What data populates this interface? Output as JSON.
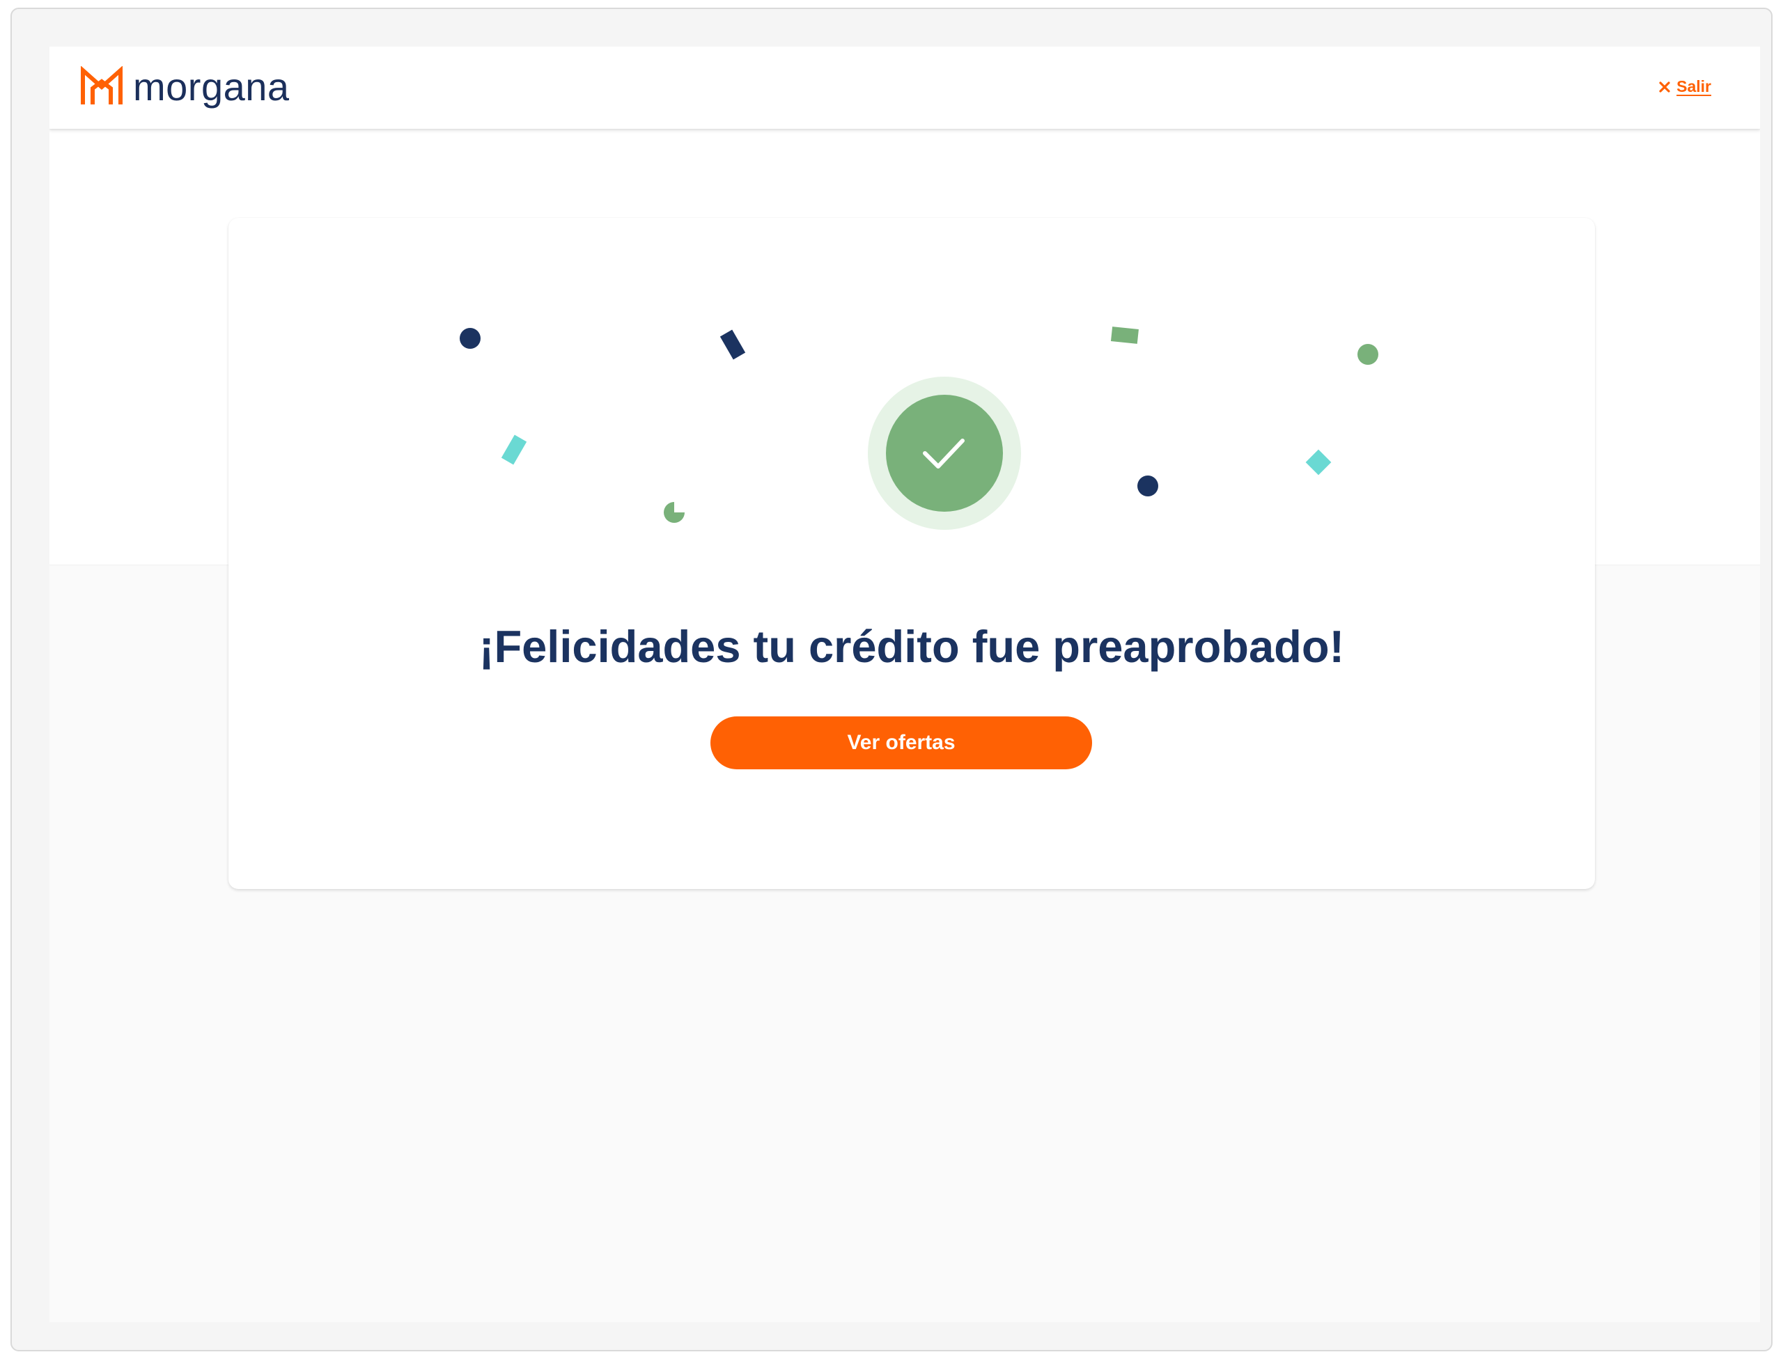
{
  "header": {
    "brand_name": "morgana",
    "logo_icon": "house-m-logo",
    "exit_icon": "close-icon",
    "exit_label": "Salir"
  },
  "success": {
    "status_icon": "check-icon",
    "headline": "¡Felicidades tu crédito fue preaprobado!",
    "cta_label": "Ver ofertas"
  },
  "colors": {
    "brand_orange": "#ff6104",
    "navy": "#1b3360",
    "success_green": "#79b17a",
    "success_halo": "#e6f3e6",
    "confetti_teal": "#6ad9d3"
  }
}
